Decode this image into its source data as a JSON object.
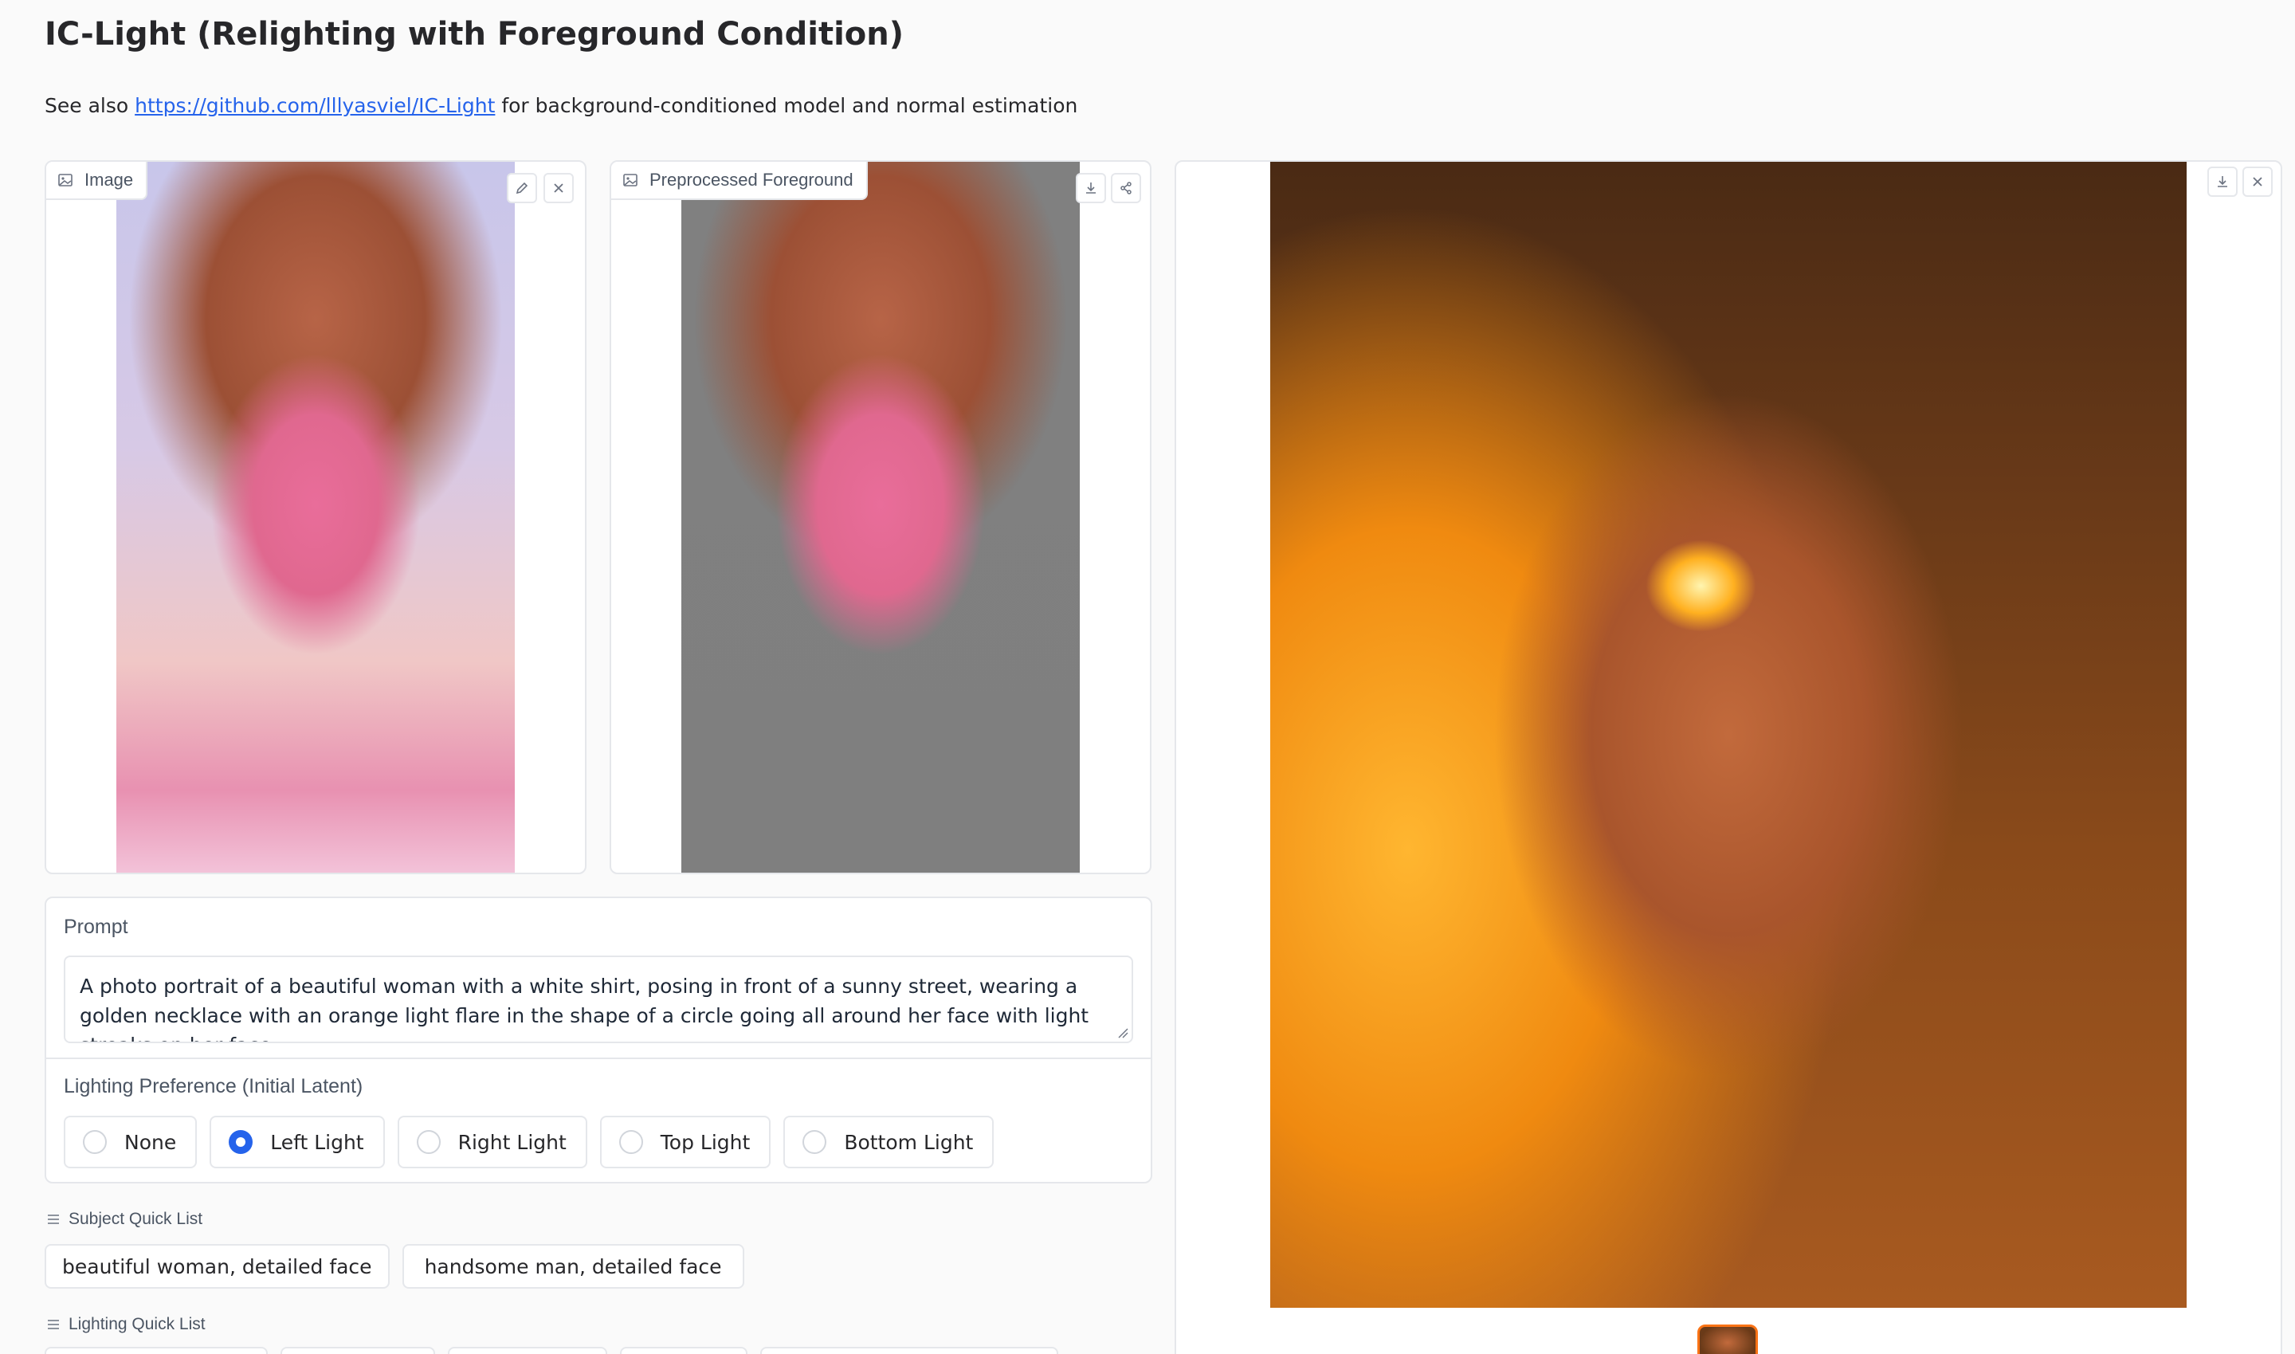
{
  "page": {
    "title": "IC-Light (Relighting with Foreground Condition)",
    "see_also_prefix": "See also ",
    "see_also_link": "https://github.com/lllyasviel/IC-Light",
    "see_also_suffix": " for background-conditioned model and normal estimation"
  },
  "image_input": {
    "label": "Image"
  },
  "preprocessed": {
    "label": "Preprocessed Foreground"
  },
  "prompt": {
    "label": "Prompt",
    "value": "A photo portrait of a beautiful woman with a white shirt, posing in front of a sunny street, wearing a golden necklace with an orange light flare in the shape of a circle going all around her face with light streaks on her face."
  },
  "lighting_preference": {
    "label": "Lighting Preference (Initial Latent)",
    "options": [
      "None",
      "Left Light",
      "Right Light",
      "Top Light",
      "Bottom Light"
    ],
    "selected": "Left Light"
  },
  "subject_quick_list": {
    "label": "Subject Quick List",
    "items": [
      "beautiful woman, detailed face",
      "handsome man, detailed face"
    ]
  },
  "lighting_quick_list": {
    "label": "Lighting Quick List"
  },
  "colors": {
    "accent": "#2563eb",
    "link": "#2563eb",
    "thumb_border": "#f97316"
  }
}
